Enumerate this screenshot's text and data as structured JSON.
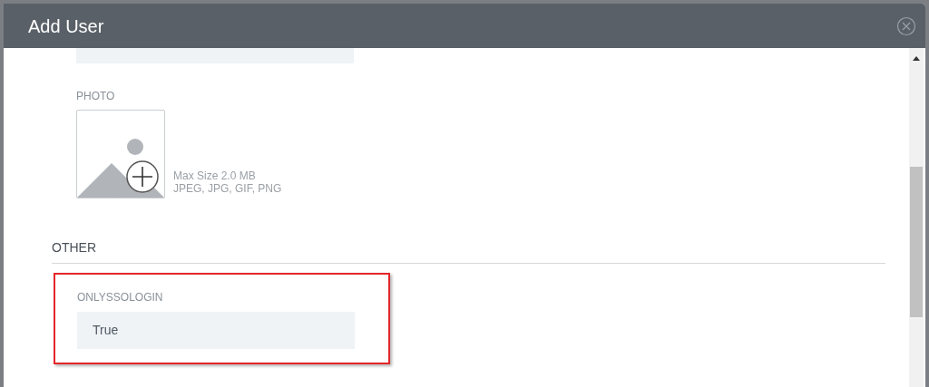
{
  "dialog": {
    "title": "Add User"
  },
  "photo": {
    "label": "PHOTO",
    "hints": [
      "Max Size 2.0 MB",
      "JPEG, JPG, GIF, PNG"
    ]
  },
  "sections": [
    {
      "title": "OTHER",
      "fields": [
        {
          "label": "ONLYSSOLOGIN",
          "value": "True",
          "highlighted": true
        }
      ]
    }
  ]
}
